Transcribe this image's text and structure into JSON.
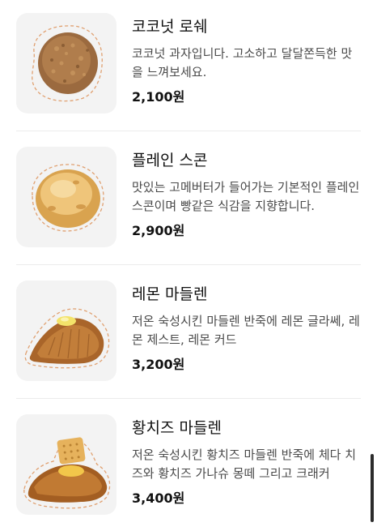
{
  "menu": {
    "items": [
      {
        "name": "코코넛 로쉐",
        "description": "코코넛 과자입니다. 고소하고 달달쫀득한 맛을 느껴보세요.",
        "price": "2,100원",
        "icon": "coconut-rocher-image"
      },
      {
        "name": "플레인 스콘",
        "description": "맛있는 고메버터가 들어가는 기본적인 플레인 스콘이며 빵같은 식감을 지향합니다.",
        "price": "2,900원",
        "icon": "plain-scone-image"
      },
      {
        "name": "레몬 마들렌",
        "description": "저온 숙성시킨 마들렌 반죽에 레몬 글라쎄, 레몬 제스트, 레몬 커드",
        "price": "3,200원",
        "icon": "lemon-madeleine-image"
      },
      {
        "name": "황치즈 마들렌",
        "description": "저온 숙성시킨 황치즈 마들렌 반죽에 체다 치즈와 황치즈 가나슈 몽떼 그리고 크래커",
        "price": "3,400원",
        "icon": "cheese-madeleine-image"
      }
    ]
  },
  "colors": {
    "thumb_background": "#f3f3f3",
    "divider": "#ececec",
    "text_primary": "#111111",
    "text_secondary": "#4a4a4a"
  }
}
